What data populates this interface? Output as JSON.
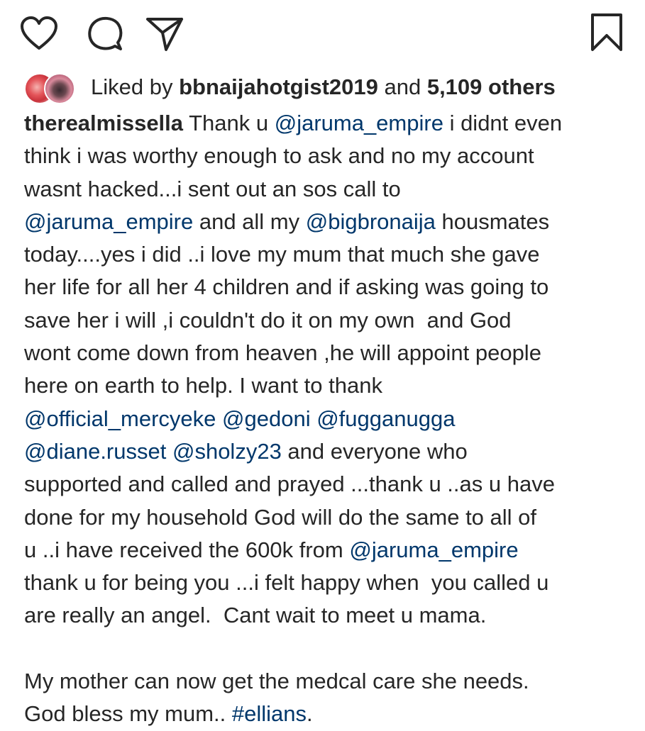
{
  "action_bar": {
    "icons": [
      "heart-icon",
      "comment-icon",
      "share-icon",
      "bookmark-icon"
    ]
  },
  "likes": {
    "prefix": "Liked by ",
    "user": "bbnaijahotgist2019",
    "middle": " and ",
    "others": "5,109 others"
  },
  "caption": {
    "username": "therealmissella",
    "lines": [
      [
        {
          "t": "username",
          "v": "therealmissella"
        },
        {
          "t": "text",
          "v": " Thank u "
        },
        {
          "t": "mention",
          "v": "@jaruma_empire"
        },
        {
          "t": "text",
          "v": " i didnt even"
        }
      ],
      [
        {
          "t": "text",
          "v": "think i was worthy enough to ask and no my account"
        }
      ],
      [
        {
          "t": "text",
          "v": "wasnt hacked...i sent out an sos call to"
        }
      ],
      [
        {
          "t": "mention",
          "v": "@jaruma_empire"
        },
        {
          "t": "text",
          "v": " and all my "
        },
        {
          "t": "mention",
          "v": "@bigbronaija"
        },
        {
          "t": "text",
          "v": " housmates"
        }
      ],
      [
        {
          "t": "text",
          "v": "today....yes i did ..i love my mum that much she gave"
        }
      ],
      [
        {
          "t": "text",
          "v": "her life for all her 4 children and if asking was going to"
        }
      ],
      [
        {
          "t": "text",
          "v": "save her i will ,i couldn't do it on my own  and God"
        }
      ],
      [
        {
          "t": "text",
          "v": "wont come down from heaven ,he will appoint people"
        }
      ],
      [
        {
          "t": "text",
          "v": "here on earth to help. I want to thank"
        }
      ],
      [
        {
          "t": "mention",
          "v": "@official_mercyeke"
        },
        {
          "t": "text",
          "v": " "
        },
        {
          "t": "mention",
          "v": "@gedoni"
        },
        {
          "t": "text",
          "v": " "
        },
        {
          "t": "mention",
          "v": "@fugganugga"
        }
      ],
      [
        {
          "t": "mention",
          "v": "@diane.russet"
        },
        {
          "t": "text",
          "v": " "
        },
        {
          "t": "mention",
          "v": "@sholzy23"
        },
        {
          "t": "text",
          "v": " and everyone who"
        }
      ],
      [
        {
          "t": "text",
          "v": "supported and called and prayed ...thank u ..as u have"
        }
      ],
      [
        {
          "t": "text",
          "v": "done for my household God will do the same to all of"
        }
      ],
      [
        {
          "t": "text",
          "v": "u ..i have received the 600k from "
        },
        {
          "t": "mention",
          "v": "@jaruma_empire"
        }
      ],
      [
        {
          "t": "text",
          "v": "thank u for being you ...i felt happy when  you called u"
        }
      ],
      [
        {
          "t": "text",
          "v": "are really an angel.  Cant wait to meet u mama."
        }
      ],
      [],
      [
        {
          "t": "text",
          "v": "My mother can now get the medcal care she needs."
        }
      ],
      [
        {
          "t": "text",
          "v": "God bless my mum.. "
        },
        {
          "t": "hashtag",
          "v": "#ellians"
        },
        {
          "t": "text",
          "v": "."
        }
      ]
    ]
  },
  "colors": {
    "text": "#262626",
    "link": "#00376b",
    "background": "#ffffff"
  }
}
